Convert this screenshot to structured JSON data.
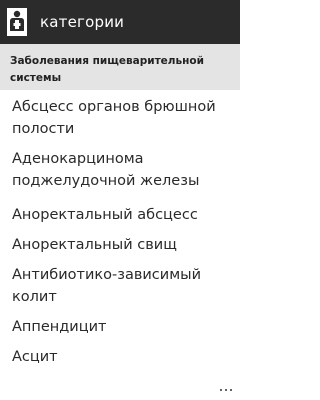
{
  "header": {
    "title": "категории",
    "icon": "app-logo-icon"
  },
  "subheader": {
    "title_line1": "Заболевания пищеварительной",
    "title_line2": "системы"
  },
  "list": {
    "items": [
      {
        "line1": "Абсцесс органов брюшной",
        "line2": "полости"
      },
      {
        "line1": "Аденокарцинома",
        "line2": "поджелудочной железы"
      },
      {
        "line1": "Аноректальный абсцесс",
        "line2": ""
      },
      {
        "line1": "Аноректальный свищ",
        "line2": ""
      },
      {
        "line1": "Антибиотико-зависимый",
        "line2": "колит"
      },
      {
        "line1": "Аппендицит",
        "line2": ""
      },
      {
        "line1": "Асцит",
        "line2": ""
      }
    ]
  },
  "appbar": {
    "more_icon": "ellipsis-icon"
  },
  "colors": {
    "header_bg": "#2b2b2b",
    "subheader_bg": "#e4e4e4",
    "text": "#2a2a2a"
  }
}
